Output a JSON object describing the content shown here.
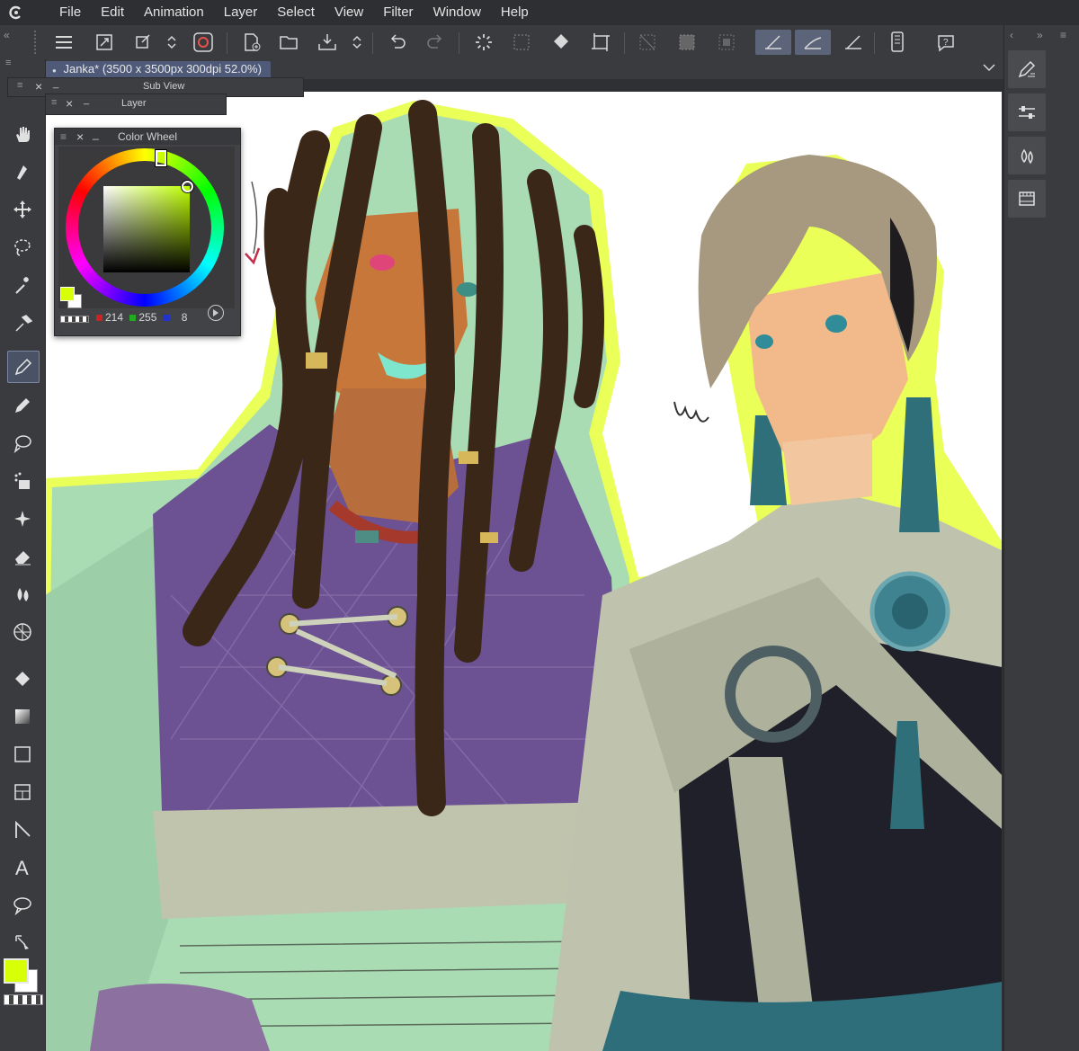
{
  "menu": {
    "items": [
      "File",
      "Edit",
      "Animation",
      "Layer",
      "Select",
      "View",
      "Filter",
      "Window",
      "Help"
    ]
  },
  "document": {
    "tab_title": "Janka* (3500 x 3500px 300dpi 52.0%)"
  },
  "panels": {
    "sub_view": "Sub View",
    "layer": "Layer",
    "color_wheel": "Color Wheel"
  },
  "color": {
    "main_hex": "#d6ff08",
    "sub_hex": "#ffffff",
    "r": "214",
    "g": "255",
    "b": "8"
  },
  "accent": "#4e5a78"
}
